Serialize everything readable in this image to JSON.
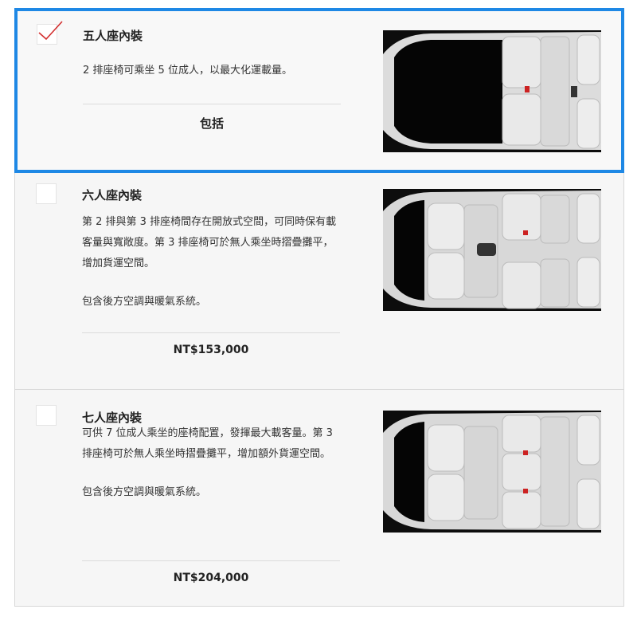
{
  "options": [
    {
      "title": "五人座內裝",
      "description": "2 排座椅可乘坐 5 位成人，以最大化運載量。",
      "extra": "",
      "price": "包括",
      "selected": true,
      "image_icon": "five-seat-interior-top-view"
    },
    {
      "title": "六人座內裝",
      "description": "第 2 排與第 3 排座椅間存在開放式空間，可同時保有載客量與寬敞度。第 3 排座椅可於無人乘坐時摺疊攤平，增加貨運空間。",
      "extra": "包含後方空調與暖氣系統。",
      "price": "NT$153,000",
      "selected": false,
      "image_icon": "six-seat-interior-top-view"
    },
    {
      "title": "七人座內裝",
      "description": "可供 7 位成人乘坐的座椅配置，發揮最大載客量。第 3 排座椅可於無人乘坐時摺疊攤平，增加額外貨運空間。",
      "extra": "包含後方空調與暖氣系統。",
      "price": "NT$204,000",
      "selected": false,
      "image_icon": "seven-seat-interior-top-view"
    }
  ],
  "colors": {
    "selected_border": "#1e88e5",
    "checkmark": "#d32f2f",
    "card_bg": "#f6f6f6"
  }
}
